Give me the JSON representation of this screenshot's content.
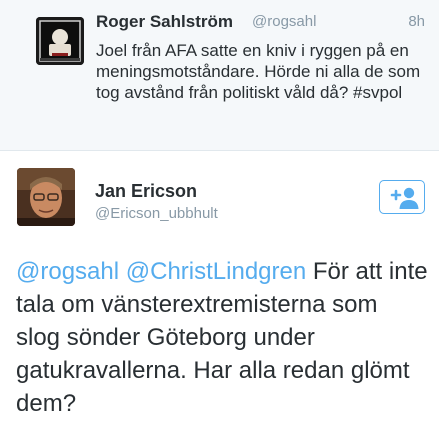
{
  "parent_tweet": {
    "author_name": "Roger Sahlström",
    "author_handle": "@rogsahl",
    "time": "8h",
    "text": "Joel från AFA satte en kniv i ryggen på en meningsmotståndare. Hörde ni alla de som tog avstånd från politiskt våld då? #svpol"
  },
  "main_tweet": {
    "author_name": "Jan Ericson",
    "author_handle": "@Ericson_ubbhult",
    "mention_1": "@rogsahl",
    "mention_2": "@ChristLindgren",
    "text": "För att inte tala om vänsterextremisterna som slog sönder Göteborg under gatukravallerna. Har alla redan glömt dem?"
  },
  "colors": {
    "accent": "#55acee",
    "secondary_text": "#8899a6",
    "primary_text": "#292f33",
    "parent_background": "#f5f8fa"
  },
  "icons": {
    "follow": "add-user-icon"
  }
}
